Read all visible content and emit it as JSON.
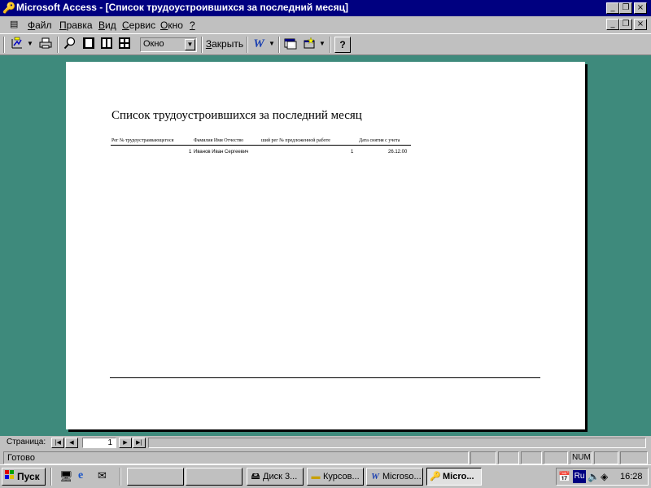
{
  "window": {
    "title": "Microsoft Access - [Список трудоустроившихся за последний месяц]",
    "controls": [
      "_",
      "❐",
      "×"
    ]
  },
  "menu": [
    {
      "label": "Файл",
      "key": "Ф",
      "rest": "айл"
    },
    {
      "label": "Правка",
      "key": "П",
      "rest": "равка"
    },
    {
      "label": "Вид",
      "key": "В",
      "rest": "ид"
    },
    {
      "label": "Сервис",
      "key": "С",
      "rest": "ервис"
    },
    {
      "label": "Окно",
      "key": "О",
      "rest": "кно"
    },
    {
      "label": "?",
      "key": "?",
      "rest": ""
    }
  ],
  "toolbar": {
    "zoom_value": "Окно",
    "close_label": "Закрыть",
    "close_key": "З",
    "close_rest": "акрыть"
  },
  "report": {
    "title": "Список трудоустроившихся за последний месяц",
    "columns": [
      "Рег № трудоустраивающегося",
      "Фамилия Имя Отчество",
      "ший рег № предложенной работе",
      "Дата снятия с учета"
    ],
    "rows": [
      {
        "reg_no": "1",
        "name": "Иванов Иван Сергеевич",
        "job_reg_no": "1",
        "date_removed": "26.12.00"
      }
    ]
  },
  "navigation": {
    "page_label": "Страница:",
    "page_number": "1"
  },
  "status": {
    "text": "Готово",
    "num_indicator": "NUM"
  },
  "taskbar": {
    "start_label": "Пуск",
    "tasks": [
      "Диск 3...",
      "Курсов...",
      "Microso...",
      "Micro..."
    ],
    "language": "Ru",
    "clock": "16:28"
  },
  "colors": {
    "titlebar": "#000080",
    "workspace": "#3e8a7c",
    "face": "#c0c0c0"
  }
}
